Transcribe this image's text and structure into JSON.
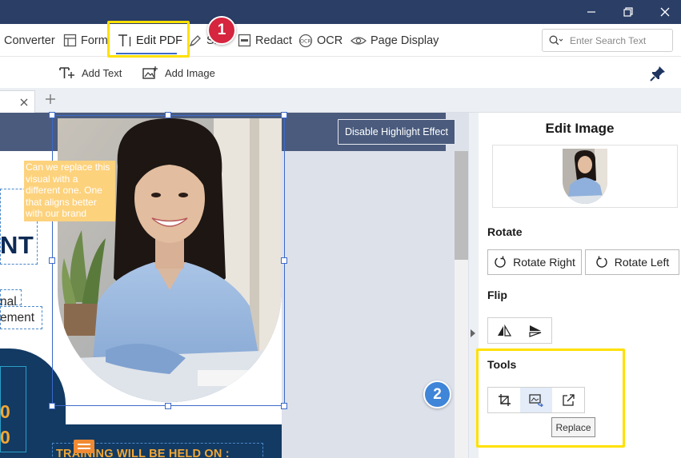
{
  "window": {
    "controls": [
      "minimize",
      "restore",
      "close"
    ]
  },
  "toolbar": {
    "converter": "Converter",
    "form": "Form",
    "edit_pdf": "Edit PDF",
    "sign_partial": "Si",
    "redact": "Redact",
    "ocr": "OCR",
    "page_display": "Page Display",
    "search_placeholder": "Enter Search Text"
  },
  "subtoolbar": {
    "add_text": "Add Text",
    "add_image": "Add Image"
  },
  "annotations": {
    "step1": "1",
    "step2": "2"
  },
  "document": {
    "highlight_button": "Disable Highlight Effect",
    "note_text": "Can we replace this visual with a different one. One that aligns better with our brand",
    "heading_fragment": "NT",
    "line1_fragment": "nal",
    "line2_fragment": "ement",
    "num1": "0",
    "num2": "0",
    "training_text": "TRAINING WILL BE HELD ON :"
  },
  "panel": {
    "title": "Edit Image",
    "rotate_label": "Rotate",
    "rotate_right": "Rotate Right",
    "rotate_left": "Rotate Left",
    "flip_label": "Flip",
    "tools_label": "Tools",
    "tooltip": "Replace"
  },
  "colors": {
    "titlebar": "#2b3e66",
    "accent": "#3c6ac9",
    "highlight_yellow": "#ffe000",
    "badge_red": "#d6253e",
    "badge_blue": "#3f85d8",
    "navy": "#123a63",
    "orange": "#f2a733"
  }
}
